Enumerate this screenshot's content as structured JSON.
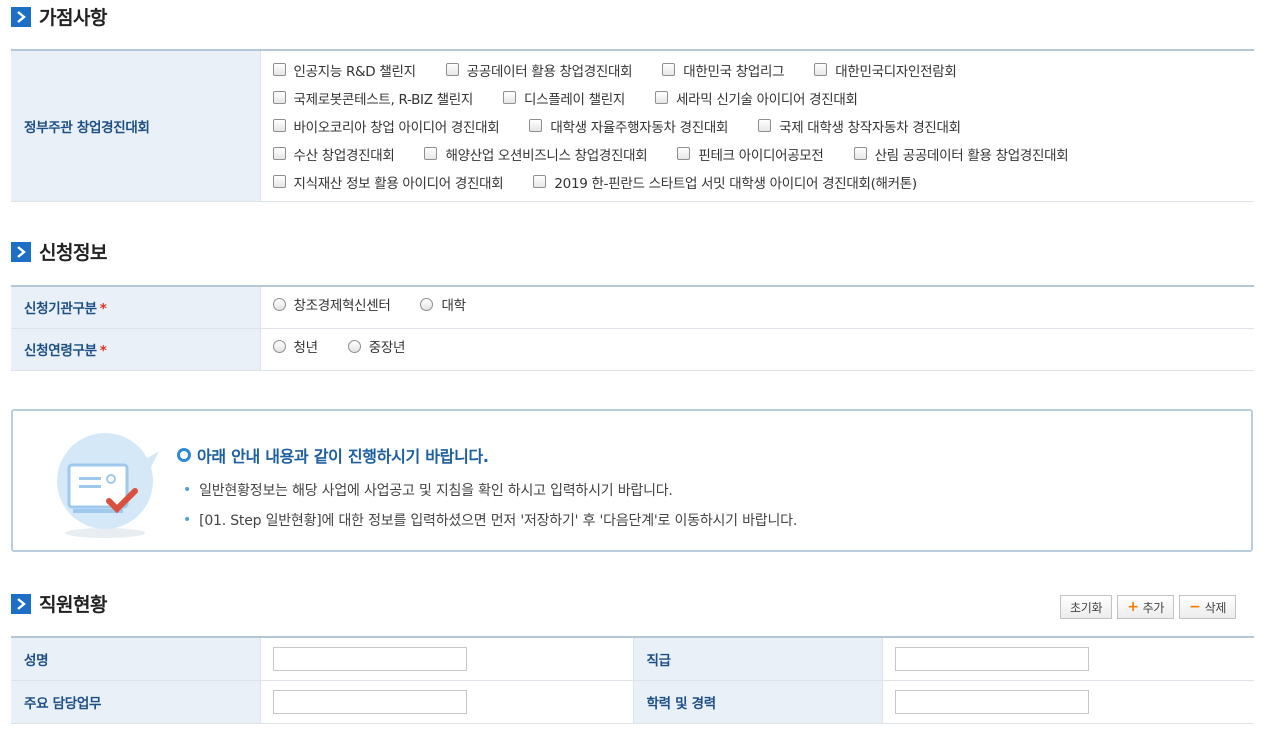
{
  "sections": {
    "bonus": "가점사항",
    "application": "신청정보",
    "staff": "직원현황"
  },
  "bonus_table": {
    "label": "정부주관 창업경진대회",
    "rows": [
      [
        "인공지능 R&D 챌린지",
        "공공데이터 활용 창업경진대회",
        "대한민국 창업리그",
        "대한민국디자인전람회"
      ],
      [
        "국제로봇콘테스트, R-BIZ 챌린지",
        "디스플레이 챌린지",
        "세라믹 신기술 아이디어 경진대회"
      ],
      [
        "바이오코리아 창업 아이디어 경진대회",
        "대학생 자율주행자동차 경진대회",
        "국제 대학생 창작자동차 경진대회"
      ],
      [
        "수산 창업경진대회",
        "해양산업 오션비즈니스 창업경진대회",
        "핀테크 아이디어공모전",
        "산림 공공데이터 활용 창업경진대회"
      ],
      [
        "지식재산 정보 활용 아이디어 경진대회",
        "2019 한-핀란드 스타트업 서밋 대학생 아이디어 경진대회(해커톤)"
      ]
    ]
  },
  "application_table": {
    "org_label": "신청기관구분",
    "org_options": [
      "창조경제혁신센터",
      "대학"
    ],
    "age_label": "신청연령구분",
    "age_options": [
      "청년",
      "중장년"
    ],
    "required_mark": "*"
  },
  "notice": {
    "title": "아래 안내 내용과 같이 진행하시기 바랍니다.",
    "lines": [
      "일반현황정보는 해당 사업에 사업공고 및 지침을 확인 하시고 입력하시기 바랍니다.",
      "[01. Step 일반현황]에 대한 정보를 입력하셨으면 먼저 '저장하기' 후 '다음단계'로 이동하시기 바랍니다."
    ]
  },
  "staff_buttons": {
    "reset": "초기화",
    "add": "추가",
    "delete": "삭제"
  },
  "staff_table": {
    "name_label": "성명",
    "position_label": "직급",
    "duty_label": "주요 담당업무",
    "career_label": "학력 및 경력",
    "name_value": "",
    "position_value": "",
    "duty_value": "",
    "career_value": ""
  },
  "colors": {
    "accent": "#1d6fc6",
    "header_bg": "#e9f0f7",
    "label_text": "#1d4f86",
    "required": "#e0341c",
    "add_icon": "#f07d00"
  }
}
